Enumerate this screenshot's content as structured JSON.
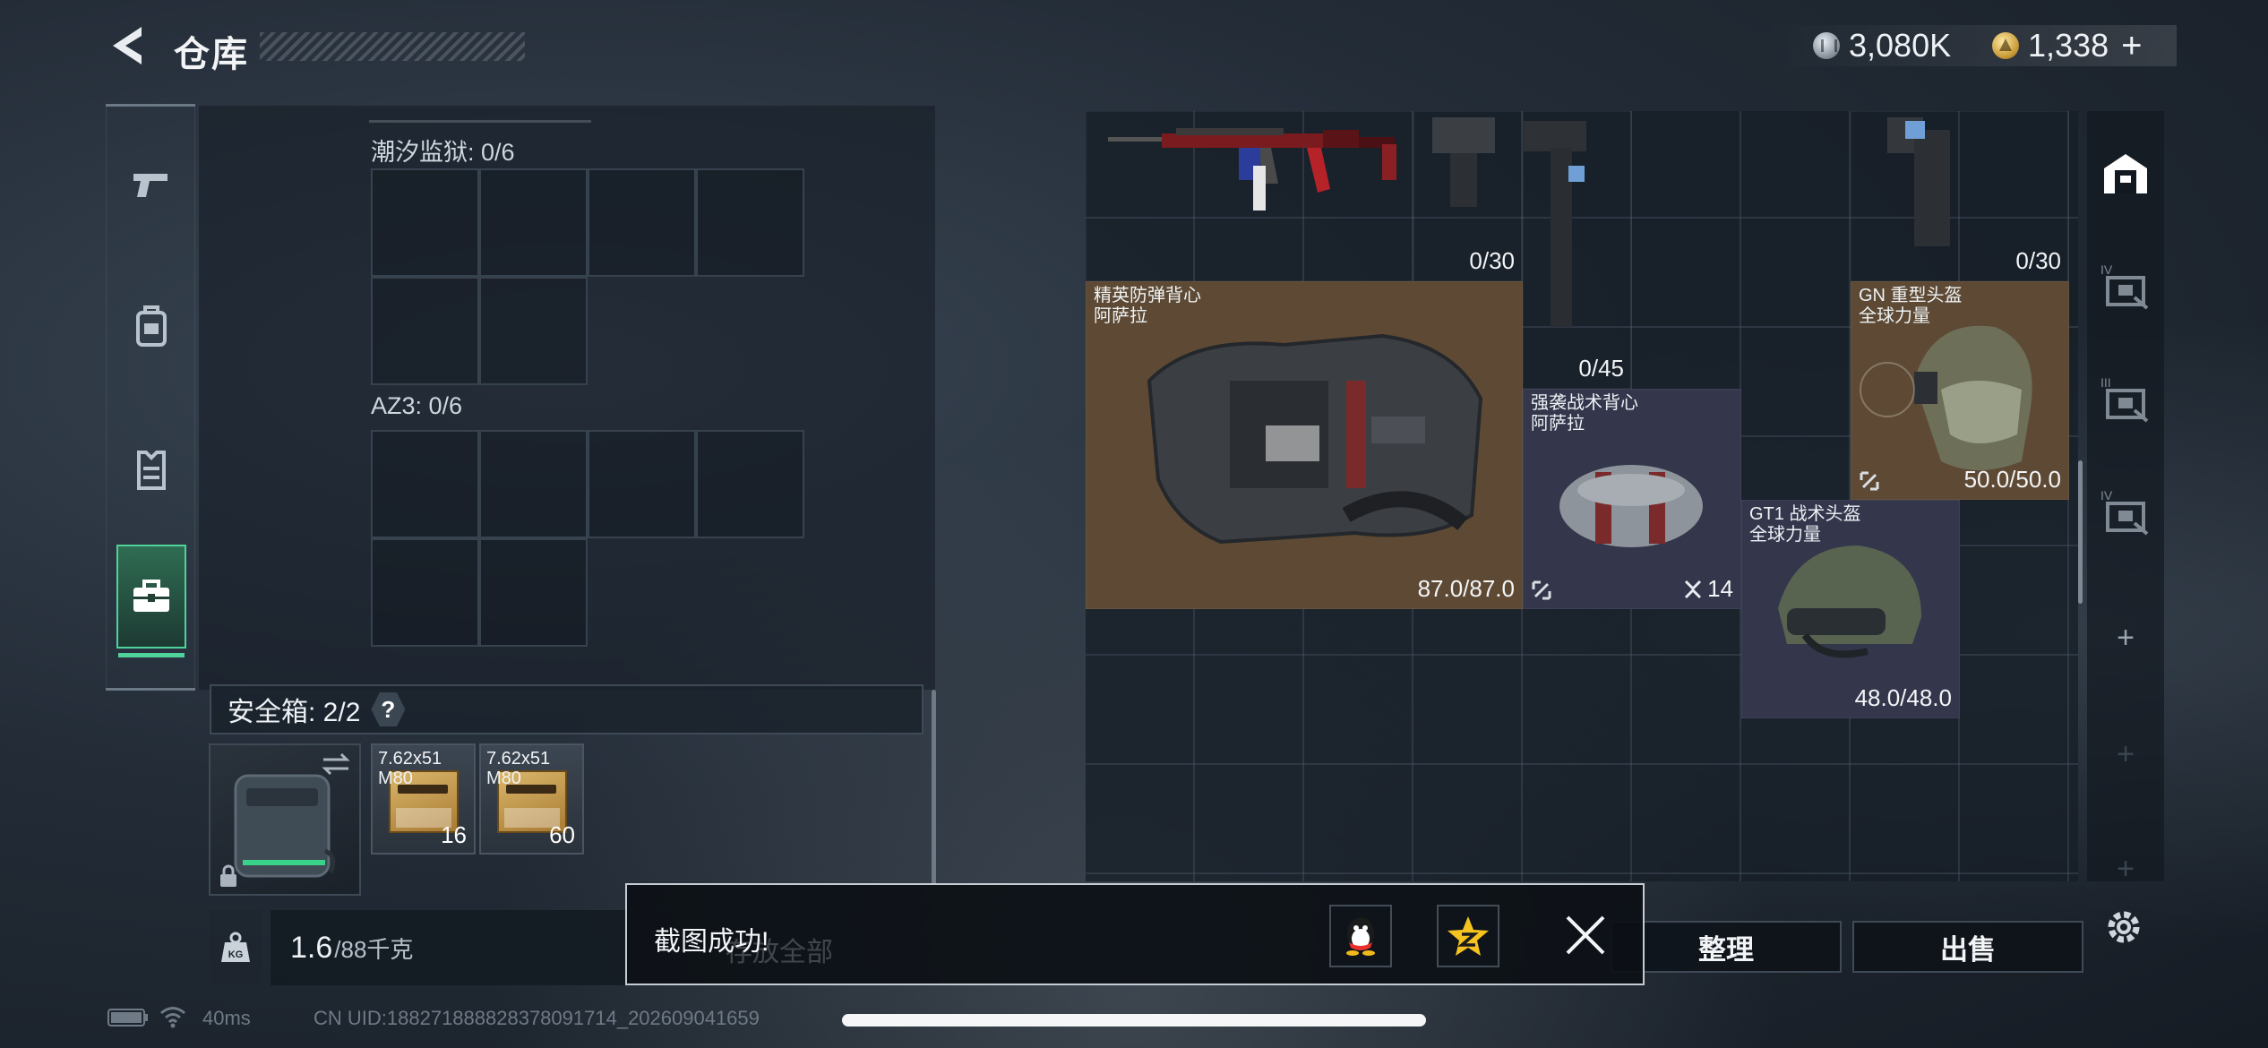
{
  "header": {
    "title": "仓库",
    "currency_silver": "3,080K",
    "currency_gold": "1,338",
    "plus_label": "+"
  },
  "rail": {
    "items": [
      {
        "icon": "pistol-icon"
      },
      {
        "icon": "backpack-icon"
      },
      {
        "icon": "vest-icon"
      },
      {
        "icon": "briefcase-icon",
        "active": true
      }
    ]
  },
  "cases": [
    {
      "label": "潮汐监狱: 0/6"
    },
    {
      "label": "AZ3: 0/6"
    }
  ],
  "safe": {
    "title": "安全箱: 2/2",
    "help": "?",
    "ammo": [
      {
        "name_line1": "7.62x51",
        "name_line2": "M80",
        "count": "16"
      },
      {
        "name_line1": "7.62x51",
        "name_line2": "M80",
        "count": "60"
      }
    ]
  },
  "weight": {
    "current": "1.6",
    "max": "/88千克",
    "icon_text": "KG"
  },
  "storage": {
    "items": [
      {
        "id": "rifle-red",
        "name": "",
        "value": ""
      },
      {
        "id": "rifle-a",
        "name": "",
        "value": "0/30"
      },
      {
        "id": "rifle-b",
        "name": "",
        "value": "0/45"
      },
      {
        "id": "rifle-c",
        "name": "",
        "value": "0/30"
      },
      {
        "id": "vest-elite",
        "name_line1": "精英防弹背心",
        "name_line2": "阿萨拉",
        "value": "87.0/87.0"
      },
      {
        "id": "bag-assault",
        "name_line1": "强袭战术背心",
        "name_line2": "阿萨拉",
        "value": "14"
      },
      {
        "id": "helmet-gn",
        "name_line1": "GN 重型头盔",
        "name_line2": "全球力量",
        "value": "50.0/50.0"
      },
      {
        "id": "helmet-gt1",
        "name_line1": "GT1 战术头盔",
        "name_line2": "全球力量",
        "value": "48.0/48.0"
      }
    ]
  },
  "right_tabs": [
    {
      "icon": "warehouse-icon"
    },
    {
      "icon": "locked-storage-icon",
      "tier": "IV"
    },
    {
      "icon": "locked-storage-icon",
      "tier": "III"
    },
    {
      "icon": "locked-storage-icon",
      "tier": "IV"
    },
    {
      "icon": "add-icon",
      "label": "+"
    },
    {
      "icon": "add-icon",
      "label": "+"
    },
    {
      "icon": "add-icon",
      "label": "+"
    }
  ],
  "actions": {
    "sort": "整理",
    "sell": "出售",
    "partial_hidden": "存放全部"
  },
  "toast": {
    "message": "截图成功!",
    "share_targets": [
      "qq-icon",
      "qzone-icon"
    ]
  },
  "status": {
    "ping": "40ms",
    "uid": "CN UID:18827188882837809171​4_202609041659"
  },
  "colors": {
    "accent_green": "#4fd39a",
    "item_brown": "#6b5236",
    "item_purple": "#3b3d58"
  }
}
